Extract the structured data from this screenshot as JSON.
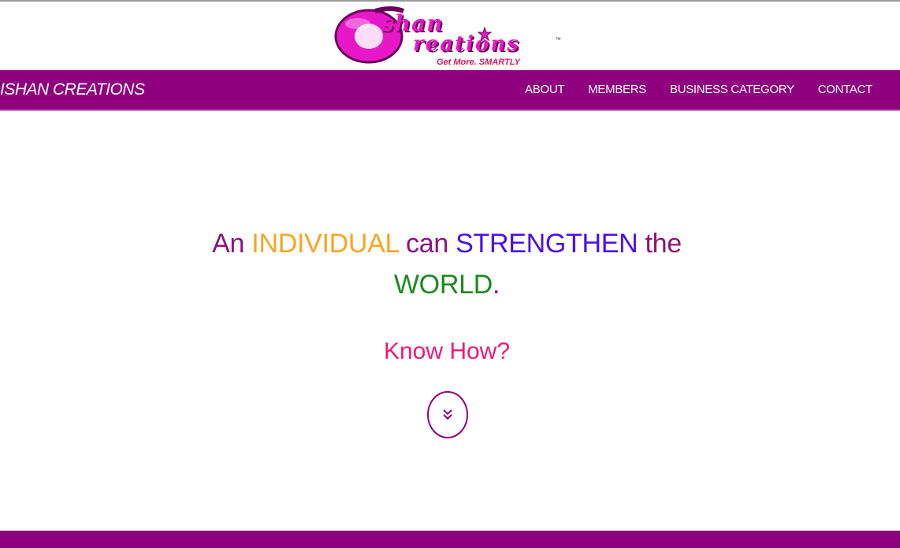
{
  "logo": {
    "word1": "shan",
    "word2": "reations",
    "tagline": "Get More. SMARTLY",
    "trademark": "™",
    "primary_color": "#e818c8"
  },
  "navbar": {
    "brand": "ISHAN CREATIONS",
    "links": [
      "ABOUT",
      "MEMBERS",
      "BUSINESS CATEGORY",
      "CONTACT"
    ],
    "background": "#8e007d"
  },
  "hero": {
    "w1": "An",
    "w2": "INDIVIDUAL",
    "w3": "can",
    "w4": "STRENGTHEN",
    "w5": "the",
    "w6": "WORLD",
    "w7": ".",
    "cta": "Know How?",
    "scroll_icon": "chevron-double-down-icon"
  }
}
